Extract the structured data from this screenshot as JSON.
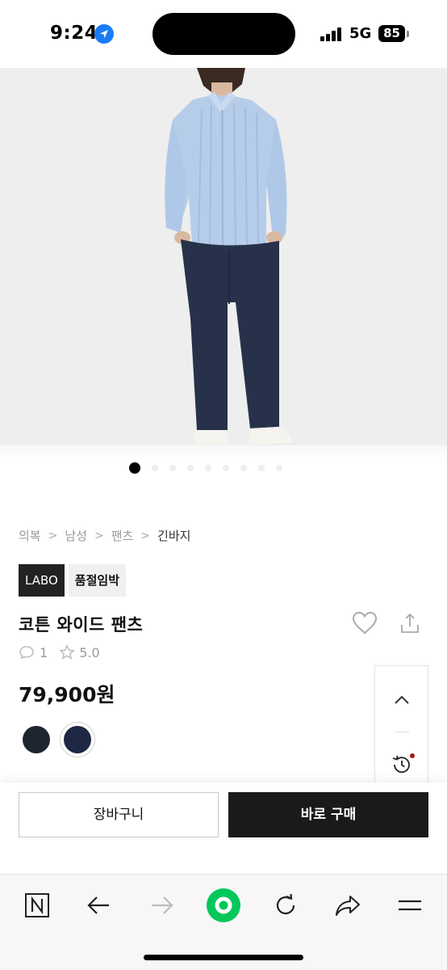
{
  "status_bar": {
    "time": "9:24",
    "network": "5G",
    "battery": "85"
  },
  "product": {
    "breadcrumb": [
      "의복",
      "남성",
      "팬츠",
      "긴바지"
    ],
    "brand_badge": "LABO",
    "status_badge": "품절임박",
    "title": "코튼 와이드 팬츠",
    "review_count": "1",
    "rating": "5.0",
    "price": "79,900원",
    "image_count": 9,
    "active_image_index": 0,
    "colors": [
      "#1c2530",
      "#1f2843"
    ],
    "selected_color_index": 1
  },
  "actions": {
    "cart_label": "장바구니",
    "buy_label": "바로 구매"
  },
  "theme": {
    "accent_green": "#03c75a",
    "dark": "#1a1a1a"
  },
  "icons": {
    "nav": [
      "naver-n-icon",
      "back-arrow-icon",
      "forward-arrow-icon",
      "home-green-icon",
      "refresh-icon",
      "share-arrow-icon",
      "menu-icon"
    ]
  }
}
